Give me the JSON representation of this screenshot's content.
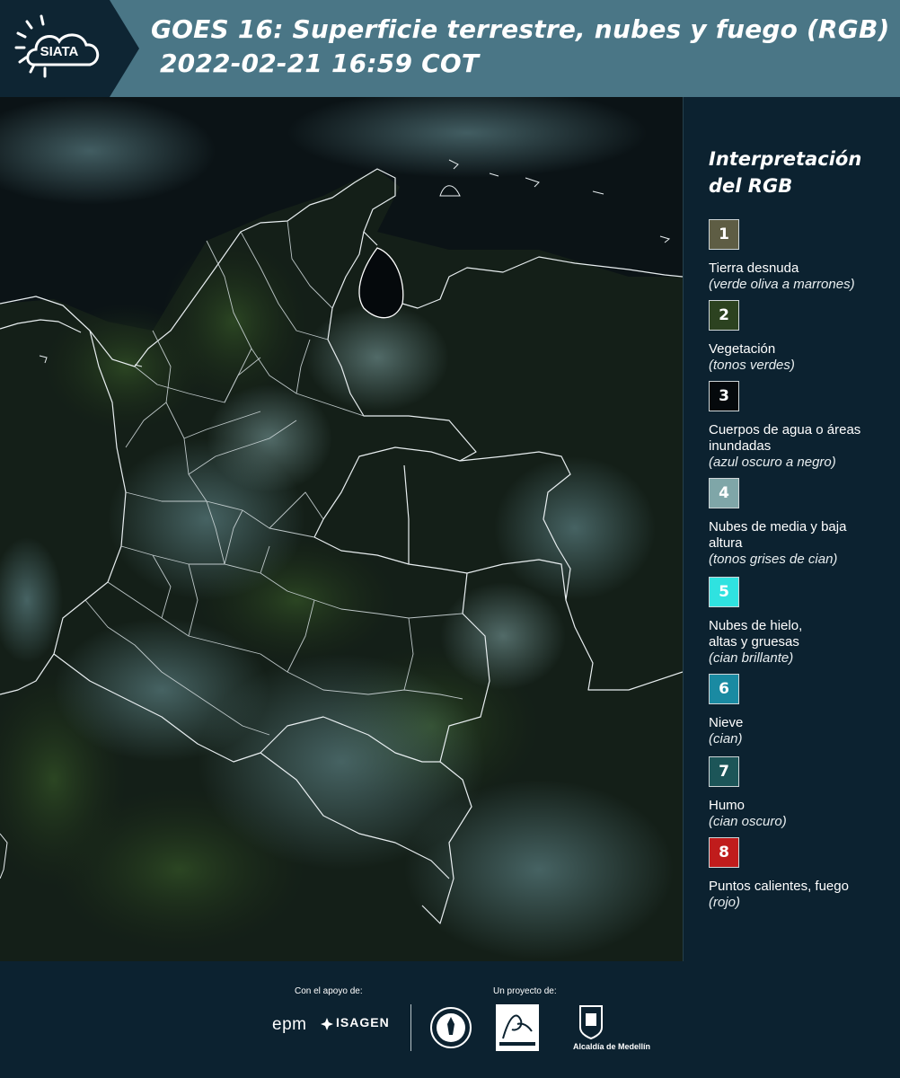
{
  "header": {
    "logo_text": "SIATA",
    "title_line1": "GOES 16: Superficie terrestre, nubes y fuego (RGB)",
    "title_line2": "2022-02-21 16:59 COT",
    "background": "#4a7686"
  },
  "legend": {
    "title": "Interpretación del RGB",
    "items": [
      {
        "number": "1",
        "label": "Tierra desnuda",
        "sub": "(verde oliva a marrones)",
        "color": "#5e5d44"
      },
      {
        "number": "2",
        "label": "Vegetación",
        "sub": "(tonos verdes)",
        "color": "#2c4220"
      },
      {
        "number": "3",
        "label": "Cuerpos de agua o áreas inundadas",
        "sub": "(azul oscuro a negro)",
        "color": "#05090c"
      },
      {
        "number": "4",
        "label": "Nubes de media y baja altura",
        "sub": "(tonos grises de cian)",
        "color": "#7fa6a8"
      },
      {
        "number": "5",
        "label": "Nubes de hielo, altas y gruesas",
        "sub": "(cian brillante)",
        "color": "#2fe2e0"
      },
      {
        "number": "6",
        "label": "Nieve",
        "sub": "(cian)",
        "color": "#1a8aa2"
      },
      {
        "number": "7",
        "label": "Humo",
        "sub": "(cian oscuro)",
        "color": "#1c5558"
      },
      {
        "number": "8",
        "label": "Puntos calientes, fuego",
        "sub": "(rojo)",
        "color": "#c01c1c"
      }
    ]
  },
  "footer": {
    "support_label": "Con el apoyo de:",
    "project_label": "Un proyecto de:",
    "epm": "epm",
    "isagen": "ISAGEN",
    "alcaldia": "Alcaldía de Medellín"
  }
}
